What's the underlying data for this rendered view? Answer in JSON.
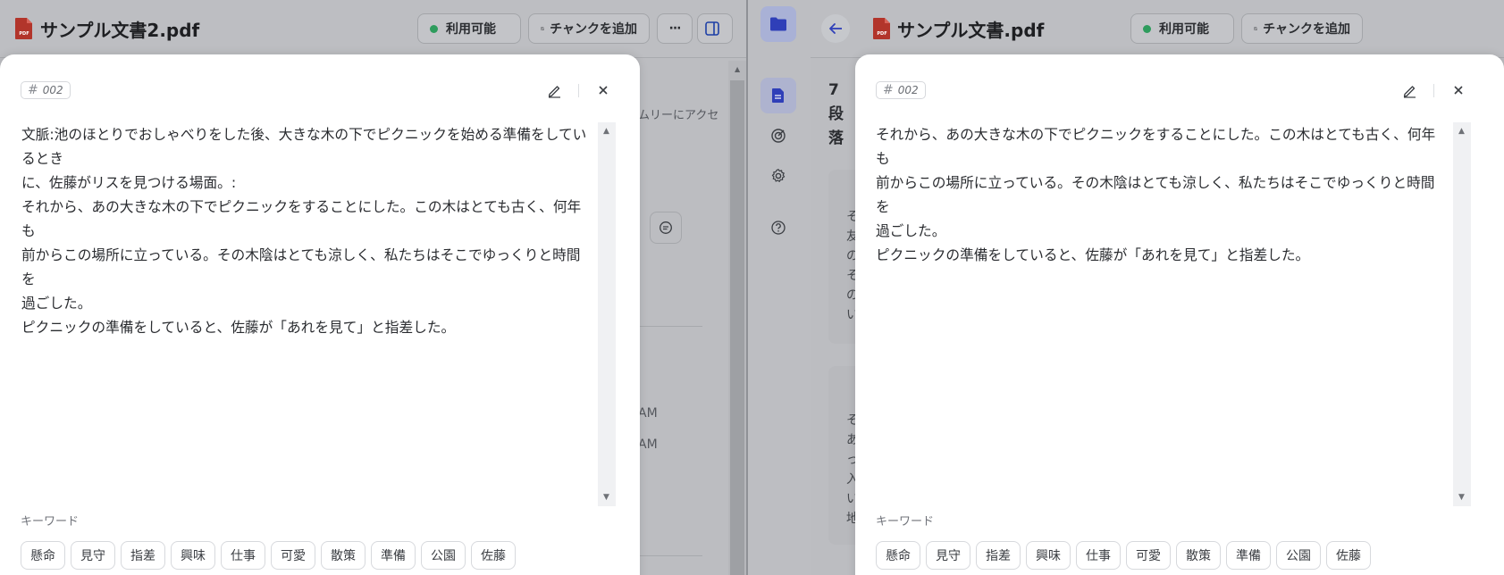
{
  "left": {
    "title": "サンプル文書2.pdf",
    "status_label": "利用可能",
    "add_chunk_label": "チャンクを追加",
    "more_label": "···",
    "bg": {
      "access_text": "ムリーにアクセ",
      "time1": "AM",
      "time2": "AM"
    },
    "modal": {
      "chunk_id": "002",
      "content": "文脈:池のほとりでおしゃべりをした後、大きな木の下でピクニックを始める準備をしているとき\nに、佐藤がリスを見つける場面。:\nそれから、あの大きな木の下でピクニックをすることにした。この木はとても古く、何年も\n前からこの場所に立っている。その木陰はとても涼しく、私たちはそこでゆっくりと時間を\n過ごした。\nピクニックの準備をしていると、佐藤が「あれを見て」と指差した。",
      "keywords_label": "キーワード",
      "keywords": [
        "懸命",
        "見守",
        "指差",
        "興味",
        "仕事",
        "可愛",
        "散策",
        "準備",
        "公園",
        "佐藤"
      ]
    }
  },
  "right": {
    "title": "サンプル文書.pdf",
    "status_label": "利用可能",
    "add_chunk_label": "チャンクを追加",
    "bg": {
      "paragraph_label": "7\n段\n落",
      "card1_text": "そ\n友\nの\nそ\nの\nい",
      "card2_text": "そ\nあ\nっ\n入\nい\n地",
      "edge_a1": "A",
      "edge_a2": "A"
    },
    "modal": {
      "chunk_id": "002",
      "content": "それから、あの大きな木の下でピクニックをすることにした。この木はとても古く、何年も\n前からこの場所に立っている。その木陰はとても涼しく、私たちはそこでゆっくりと時間を\n過ごした。\nピクニックの準備をしていると、佐藤が「あれを見て」と指差した。",
      "keywords_label": "キーワード",
      "keywords": [
        "懸命",
        "見守",
        "指差",
        "興味",
        "仕事",
        "可愛",
        "散策",
        "準備",
        "公園",
        "佐藤"
      ]
    }
  },
  "colors": {
    "accent": "#3b4fc4",
    "status_green": "#2e9c5d",
    "pdf_red": "#c0392b"
  },
  "icons": [
    "pdf-icon",
    "pencil-icon",
    "close-icon",
    "add-chunk-icon",
    "panel-icon",
    "folder-icon",
    "back-arrow-icon",
    "document-icon",
    "target-icon",
    "settings-icon",
    "help-icon",
    "chat-icon"
  ]
}
